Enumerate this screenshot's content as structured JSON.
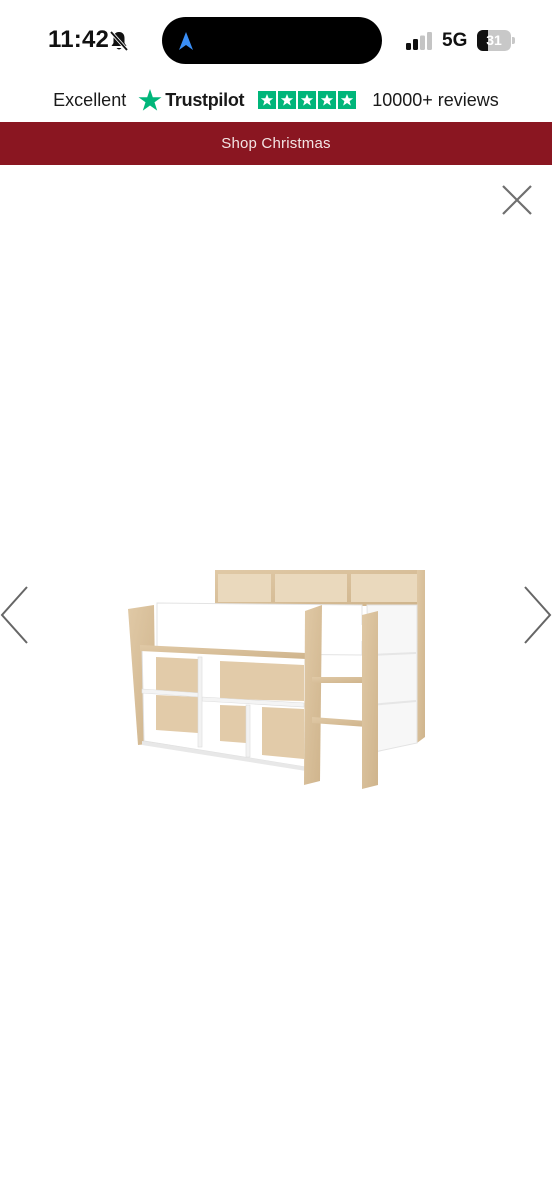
{
  "status_bar": {
    "time": "11:42",
    "network": "5G",
    "battery_level": "31",
    "icons": [
      "bell-slash-icon",
      "location-arrow-icon",
      "signal-icon",
      "battery-icon"
    ]
  },
  "trustpilot": {
    "rating_word": "Excellent",
    "brand": "Trustpilot",
    "stars": 5,
    "reviews": "10000+ reviews",
    "brand_color": "#00b67a"
  },
  "promo": {
    "text": "Shop Christmas",
    "background": "#8a1621"
  },
  "viewer": {
    "close_icon": "close-icon",
    "prev_icon": "chevron-left-icon",
    "next_icon": "chevron-right-icon",
    "image": "product-photo-mid-sleeper-bed"
  }
}
